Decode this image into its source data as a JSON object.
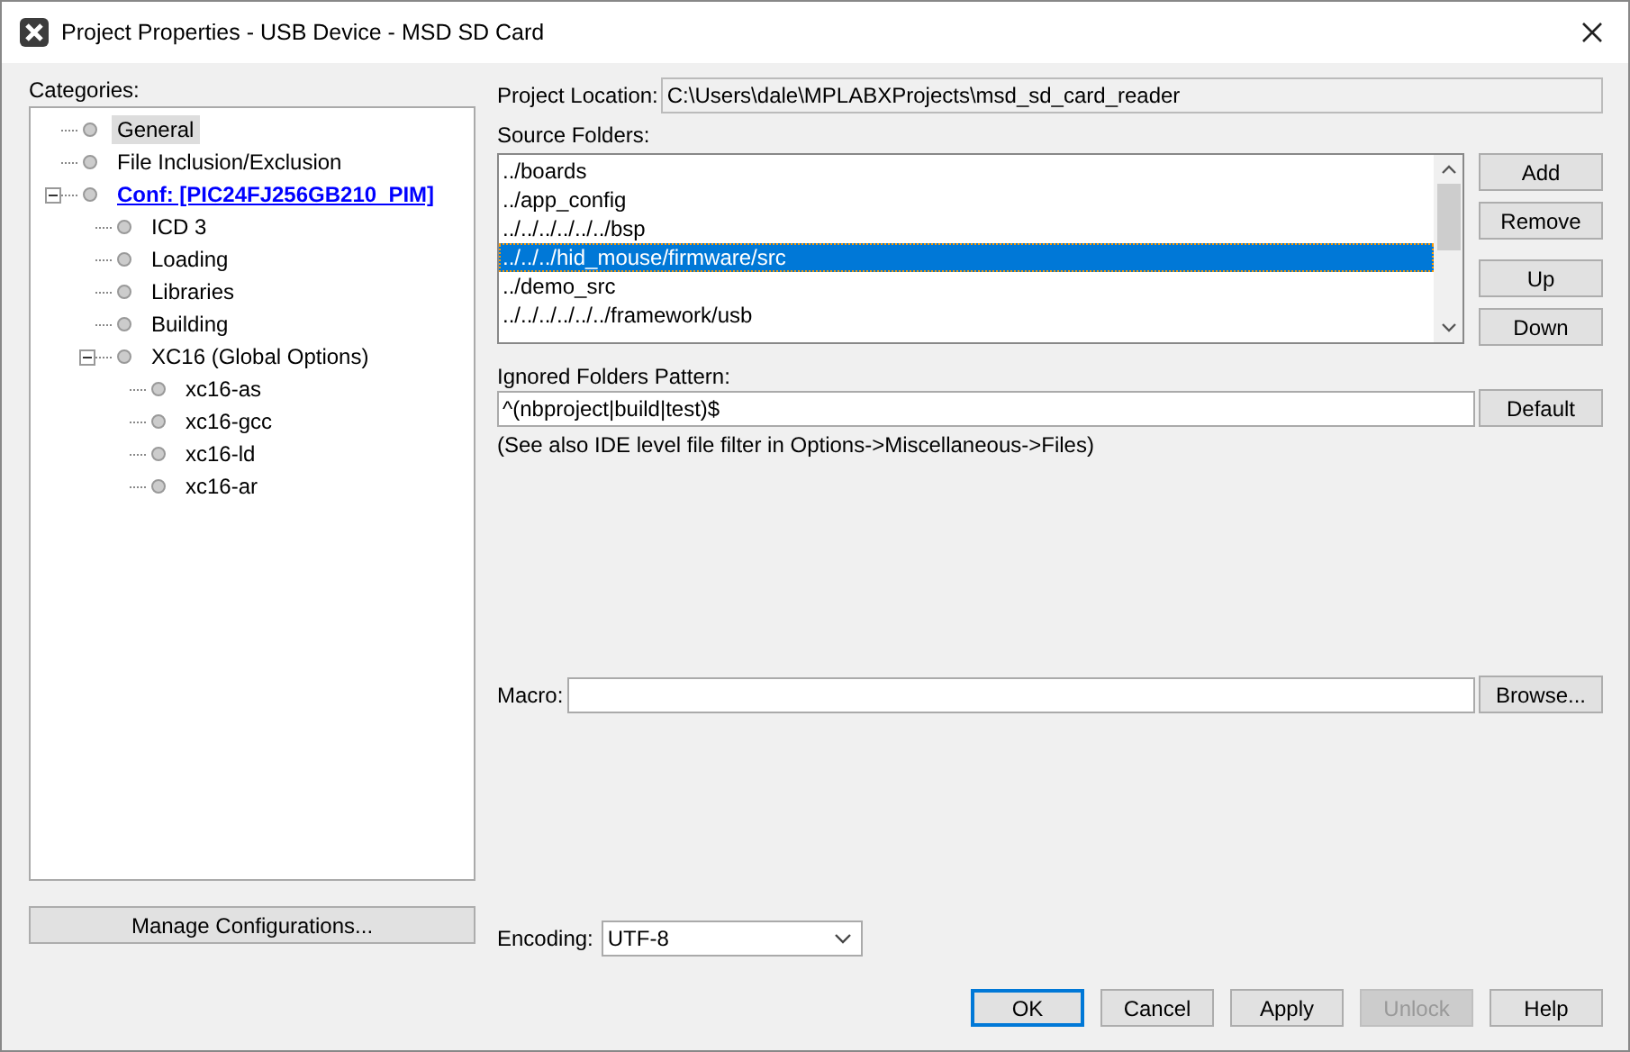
{
  "window": {
    "title": "Project Properties - USB Device - MSD SD Card"
  },
  "categories": {
    "label": "Categories:",
    "items": [
      {
        "label": "General",
        "link": false,
        "selected": true
      },
      {
        "label": "File Inclusion/Exclusion",
        "link": false,
        "selected": false
      },
      {
        "label": "Conf: [PIC24FJ256GB210_PIM]",
        "link": true,
        "selected": false,
        "expanded": true,
        "children": [
          {
            "label": "ICD 3",
            "link": false,
            "selected": false
          },
          {
            "label": "Loading",
            "link": false,
            "selected": false
          },
          {
            "label": "Libraries",
            "link": false,
            "selected": false
          },
          {
            "label": "Building",
            "link": false,
            "selected": false
          },
          {
            "label": "XC16 (Global Options)",
            "link": false,
            "selected": false,
            "expanded": true,
            "children": [
              {
                "label": "xc16-as",
                "link": false,
                "selected": false
              },
              {
                "label": "xc16-gcc",
                "link": false,
                "selected": false
              },
              {
                "label": "xc16-ld",
                "link": false,
                "selected": false
              },
              {
                "label": "xc16-ar",
                "link": false,
                "selected": false
              }
            ]
          }
        ]
      }
    ]
  },
  "manage_button": "Manage Configurations...",
  "project_location": {
    "label": "Project Location:",
    "value": "C:\\Users\\dale\\MPLABXProjects\\msd_sd_card_reader"
  },
  "source_folders": {
    "label": "Source Folders:",
    "items": [
      {
        "path": "../boards",
        "selected": false
      },
      {
        "path": "../app_config",
        "selected": false
      },
      {
        "path": "../../../../../../bsp",
        "selected": false
      },
      {
        "path": "../../../hid_mouse/firmware/src",
        "selected": true
      },
      {
        "path": "../demo_src",
        "selected": false
      },
      {
        "path": "../../../../../../framework/usb",
        "selected": false
      }
    ],
    "buttons": [
      "Add",
      "Remove",
      "Up",
      "Down"
    ]
  },
  "ignored_pattern": {
    "label": "Ignored Folders Pattern:",
    "value": "^(nbproject|build|test)$",
    "button": "Default",
    "note": "(See also IDE level file filter in Options->Miscellaneous->Files)"
  },
  "macro": {
    "label": "Macro:",
    "button": "Browse..."
  },
  "encoding": {
    "label": "Encoding:",
    "value": "UTF-8"
  },
  "buttons": [
    {
      "label": "OK",
      "default": true,
      "disabled": false
    },
    {
      "label": "Cancel",
      "default": false,
      "disabled": false
    },
    {
      "label": "Apply",
      "default": false,
      "disabled": false
    },
    {
      "label": "Unlock",
      "default": false,
      "disabled": true
    },
    {
      "label": "Help",
      "default": false,
      "disabled": false
    }
  ]
}
